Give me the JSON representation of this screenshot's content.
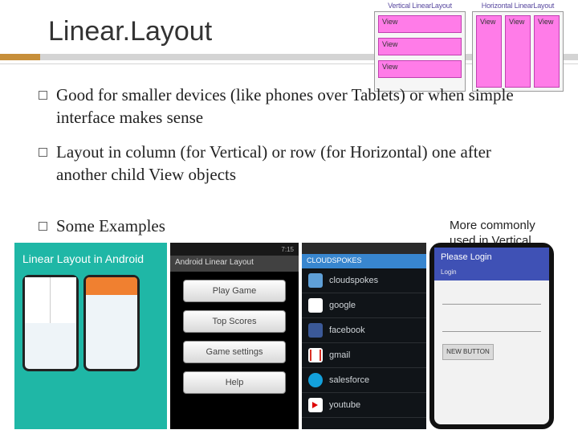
{
  "title": "Linear.Layout",
  "diagram": {
    "vertical_label": "Vertical LinearLayout",
    "horizontal_label": "Horizontal LinearLayout",
    "view_label": "View"
  },
  "bullets": [
    "Good for smaller devices (like phones over Tablets) or when simple interface makes sense",
    "Layout in column (for Vertical) or row (for Horizontal) one after another child View objects",
    "Some Examples"
  ],
  "annotation": "More commonly used in Vertical Orientation",
  "examples": {
    "ex1": {
      "banner": "Linear Layout in Android"
    },
    "ex2": {
      "status_time": "7:15",
      "titlebar": "Android Linear Layout",
      "buttons": [
        "Play Game",
        "Top Scores",
        "Game settings",
        "Help"
      ]
    },
    "ex3": {
      "header": "CLOUDSPOKES",
      "items": [
        "cloudspokes",
        "google",
        "facebook",
        "gmail",
        "salesforce",
        "youtube"
      ]
    },
    "ex4": {
      "bar": "Please Login",
      "sub": "Login",
      "fields": [
        "",
        ""
      ],
      "button": "NEW BUTTON"
    }
  }
}
